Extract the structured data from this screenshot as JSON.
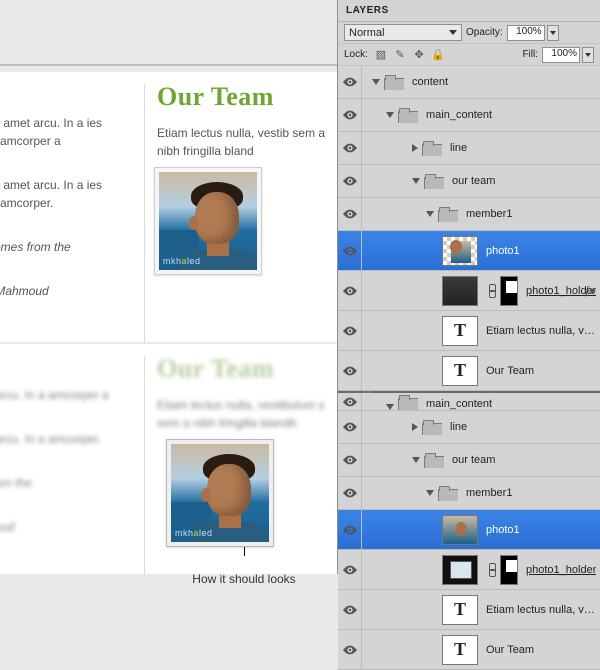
{
  "content": {
    "heading": "Our Team",
    "left_p1": "sit amet arcu. In a ies ullamcorper a",
    "left_p2": "sit amet arcu. In a ies ullamcorper.",
    "left_p3_a": "comes from the",
    "left_p3_b": "- Mahmoud",
    "descr": "Etiam lectus nulla, vestib sem a nibh fringilla bland",
    "watermark_pre": "mkh",
    "watermark_bold": "a",
    "watermark_post": "led",
    "bot_heading": "Our Team",
    "bot_left_p1": "t arcu. In a amcorper a",
    "bot_left_p2": "t arcu. In a amcorper.",
    "bot_left_p3_a": "from the",
    "bot_left_p3_b": "houd",
    "bot_descr": "Etiam lectus nulla, vestibulum s sem a nibh fringilla blandit.",
    "caption": "How it should looks"
  },
  "panel": {
    "tab": "LAYERS",
    "blend_mode": "Normal",
    "opacity_label": "Opacity:",
    "opacity_value": "100%",
    "lock_label": "Lock:",
    "fill_label": "Fill:",
    "fill_value": "100%"
  },
  "layers_top": [
    {
      "type": "folder",
      "indent": 0,
      "twisty": "open",
      "name": "content"
    },
    {
      "type": "folder",
      "indent": 14,
      "twisty": "open",
      "name": "main_content"
    },
    {
      "type": "folder",
      "indent": 40,
      "twisty": "closed",
      "name": "line"
    },
    {
      "type": "folder",
      "indent": 40,
      "twisty": "open",
      "name": "our team"
    },
    {
      "type": "folder",
      "indent": 54,
      "twisty": "open",
      "name": "member1"
    },
    {
      "type": "photo-sel",
      "indent": 70,
      "name": "photo1"
    },
    {
      "type": "photo-holder",
      "indent": 70,
      "name": "photo1_holder",
      "fx": true,
      "underline": true
    },
    {
      "type": "text",
      "indent": 70,
      "name": "Etiam lectus nulla, vestibulum v..."
    },
    {
      "type": "text",
      "indent": 70,
      "name": "Our Team"
    }
  ],
  "layers_bot": [
    {
      "type": "folder",
      "indent": 14,
      "twisty": "open",
      "name": "main_content",
      "cut": true
    },
    {
      "type": "folder",
      "indent": 40,
      "twisty": "closed",
      "name": "line"
    },
    {
      "type": "folder",
      "indent": 40,
      "twisty": "open",
      "name": "our team"
    },
    {
      "type": "folder",
      "indent": 54,
      "twisty": "open",
      "name": "member1"
    },
    {
      "type": "photo-sel",
      "indent": 70,
      "name": "photo1"
    },
    {
      "type": "photo-holder-bot",
      "indent": 70,
      "name": "photo1_holder",
      "underline": true
    },
    {
      "type": "text",
      "indent": 70,
      "name": "Etiam lectus nulla, vestibulum vel"
    },
    {
      "type": "text",
      "indent": 70,
      "name": "Our Team"
    }
  ]
}
